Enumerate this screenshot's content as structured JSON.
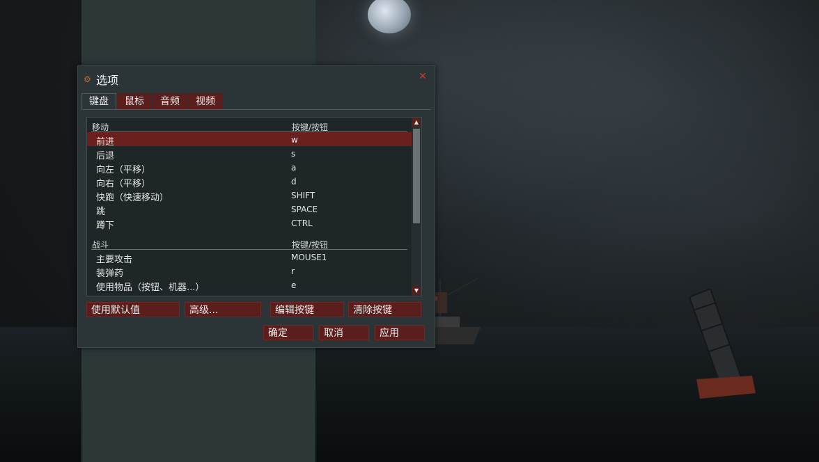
{
  "dialog": {
    "title": "选项",
    "icon": "gear-icon",
    "close_icon": "close-icon"
  },
  "tabs": [
    {
      "label": "键盘",
      "active": true
    },
    {
      "label": "鼠标",
      "active": false
    },
    {
      "label": "音频",
      "active": false
    },
    {
      "label": "视频",
      "active": false
    }
  ],
  "sections": [
    {
      "header": "移动",
      "column": "按键/按钮",
      "rows": [
        {
          "action": "前进",
          "key": "w",
          "selected": true
        },
        {
          "action": "后退",
          "key": "s"
        },
        {
          "action": "向左（平移）",
          "key": "a"
        },
        {
          "action": "向右（平移）",
          "key": "d"
        },
        {
          "action": "快跑（快速移动）",
          "key": "SHIFT"
        },
        {
          "action": "跳",
          "key": "SPACE"
        },
        {
          "action": "蹲下",
          "key": "CTRL"
        }
      ]
    },
    {
      "header": "战斗",
      "column": "按键/按钮",
      "rows": [
        {
          "action": "主要攻击",
          "key": "MOUSE1"
        },
        {
          "action": "装弹药",
          "key": "r"
        },
        {
          "action": "使用物品（按钮、机器...）",
          "key": "e"
        }
      ]
    }
  ],
  "buttons": {
    "use_defaults": "使用默认值",
    "advanced": "高级...",
    "edit_key": "编辑按键",
    "clear_key": "清除按键",
    "ok": "确定",
    "cancel": "取消",
    "apply": "应用"
  },
  "colors": {
    "accent": "#5a1e1c",
    "selected_row": "#6a201d",
    "dialog_bg": "#2b3436",
    "close": "#c83a2e"
  }
}
